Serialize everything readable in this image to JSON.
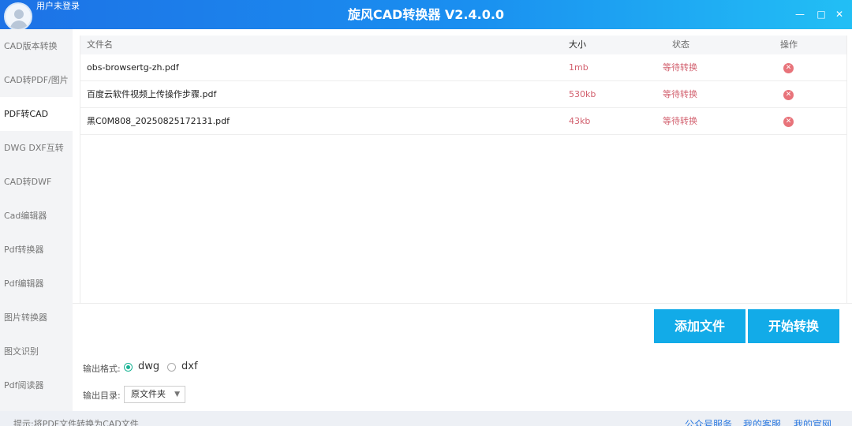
{
  "app": {
    "title": "旋风CAD转换器 V2.4.0.0",
    "user_label": "用户未登录",
    "window_controls": [
      "minimize-icon",
      "maximize-icon",
      "close-icon"
    ],
    "accent_color": "#12abe8"
  },
  "sidebar": {
    "items": [
      {
        "label": "CAD版本转换",
        "active": false
      },
      {
        "label": "CAD转PDF/图片",
        "active": false
      },
      {
        "label": "PDF转CAD",
        "active": true
      },
      {
        "label": "DWG DXF互转",
        "active": false
      },
      {
        "label": "CAD转DWF",
        "active": false
      },
      {
        "label": "Cad编辑器",
        "active": false
      },
      {
        "label": "Pdf转换器",
        "active": false
      },
      {
        "label": "Pdf编辑器",
        "active": false
      },
      {
        "label": "图片转换器",
        "active": false
      },
      {
        "label": "图文识别",
        "active": false
      },
      {
        "label": "Pdf阅读器",
        "active": false
      }
    ]
  },
  "table": {
    "headers": {
      "name": "文件名",
      "size": "大小",
      "status": "状态",
      "action": "操作"
    },
    "rows": [
      {
        "name": "obs-browsertg-zh.pdf",
        "size": "1mb",
        "status": "等待转换",
        "action_icon": "delete-icon"
      },
      {
        "name": "百度云软件视频上传操作步骤.pdf",
        "size": "530kb",
        "status": "等待转换",
        "action_icon": "delete-icon"
      },
      {
        "name": "黑C0M808_20250825172131.pdf",
        "size": "43kb",
        "status": "等待转换",
        "action_icon": "delete-icon"
      }
    ]
  },
  "buttons": {
    "add_file": "添加文件",
    "start_convert": "开始转换"
  },
  "output": {
    "format_label": "输出格式:",
    "formats": [
      {
        "label": "dwg",
        "selected": true
      },
      {
        "label": "dxf",
        "selected": false
      }
    ],
    "dir_label": "输出目录:",
    "dir_value": "原文件夹"
  },
  "footer": {
    "tip": "提示:将PDF文件转换为CAD文件",
    "links": [
      "公众号服务",
      "我的客服",
      "我的官网"
    ]
  }
}
